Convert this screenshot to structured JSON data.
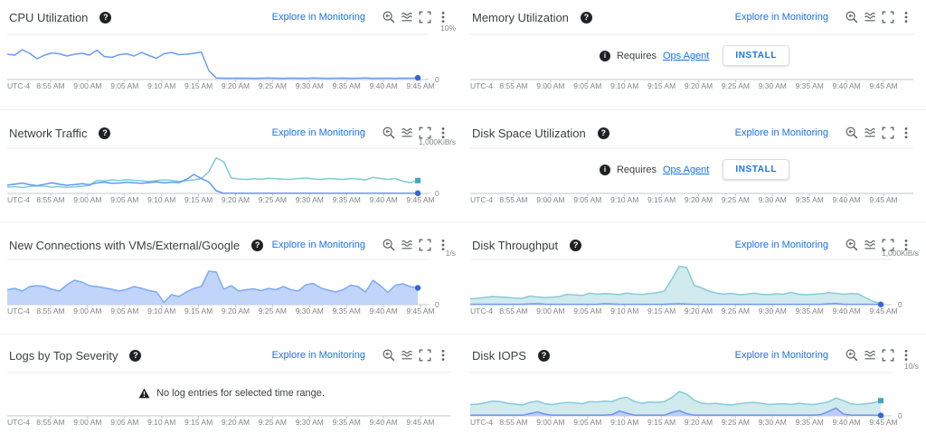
{
  "common": {
    "explore_label": "Explore in Monitoring",
    "help_glyph": "?",
    "tz_label": "UTC-4",
    "x_ticks": [
      "8:55 AM",
      "9:00 AM",
      "9:05 AM",
      "9:10 AM",
      "9:15 AM",
      "9:20 AM",
      "9:25 AM",
      "9:30 AM",
      "9:35 AM",
      "9:40 AM",
      "9:45 AM"
    ],
    "action_icons": [
      "zoom-reset-icon",
      "chart-options-icon",
      "fullscreen-icon",
      "more-options-icon"
    ],
    "colors": {
      "link": "#1a73e8",
      "blue_line": "#699cf7",
      "teal_line": "#7fcbd5",
      "blue_marker": "#3367d6",
      "teal_marker": "#41a8b8",
      "gridline": "#e8eaed",
      "axis": "#c4c7ca",
      "tick_text": "#80868b"
    }
  },
  "ops_message": {
    "info_glyph": "i",
    "requires": "Requires",
    "link": "Ops Agent",
    "install": "INSTALL"
  },
  "logs_message": {
    "text": "No log entries for selected time range."
  },
  "panels": [
    {
      "title": "CPU Utilization",
      "kind": "chart",
      "chart_index": 0
    },
    {
      "title": "Memory Utilization",
      "kind": "ops"
    },
    {
      "title": "Network Traffic",
      "kind": "chart",
      "chart_index": 1
    },
    {
      "title": "Disk Space Utilization",
      "kind": "ops"
    },
    {
      "title": "New Connections with VMs/External/Google",
      "kind": "chart",
      "chart_index": 2
    },
    {
      "title": "Disk Throughput",
      "kind": "chart",
      "chart_index": 3
    },
    {
      "title": "Logs by Top Severity",
      "kind": "logs"
    },
    {
      "title": "Disk IOPS",
      "kind": "chart",
      "chart_index": 4
    }
  ],
  "chart_data": [
    {
      "id": "cpu-utilization",
      "type": "line",
      "title": "CPU Utilization",
      "ylabel_top": "10%",
      "ylabel_bottom": "0",
      "ylim": [
        0,
        10
      ],
      "unit": "%",
      "series": [
        {
          "id": "series_blue",
          "color": "#699cf7",
          "marker": "circle",
          "marker_color": "#3367d6",
          "values": [
            5.6,
            5.4,
            6.6,
            5.8,
            4.6,
            5.4,
            5.9,
            5.7,
            5.2,
            5.6,
            5.8,
            5.4,
            6.5,
            5.1,
            4.9,
            5.5,
            5.7,
            5.2,
            6.0,
            5.3,
            4.7,
            5.7,
            6.0,
            5.5,
            5.6,
            5.8,
            6.1,
            2.0,
            0.35,
            0.3,
            0.3,
            0.32,
            0.3,
            0.28,
            0.3,
            0.33,
            0.3,
            0.28,
            0.32,
            0.3,
            0.28,
            0.35,
            0.3,
            0.28,
            0.3,
            0.32,
            0.28,
            0.3,
            0.33,
            0.28,
            0.3,
            0.3,
            0.28,
            0.32,
            0.3,
            0.38
          ]
        }
      ]
    },
    {
      "id": "network-traffic",
      "type": "line",
      "title": "Network Traffic",
      "ylabel_top": "1,000KiB/s",
      "ylabel_bottom": "0",
      "ylim": [
        0,
        1000
      ],
      "unit": "KiB/s",
      "series": [
        {
          "id": "series_teal",
          "color": "#7fcbd5",
          "marker": "square",
          "marker_color": "#41a8b8",
          "values": [
            140,
            150,
            130,
            155,
            170,
            160,
            140,
            150,
            135,
            145,
            160,
            175,
            290,
            280,
            300,
            285,
            305,
            290,
            280,
            265,
            285,
            300,
            290,
            265,
            285,
            300,
            330,
            480,
            790,
            700,
            345,
            320,
            310,
            325,
            315,
            335,
            325,
            315,
            310,
            330,
            340,
            320,
            310,
            330,
            320,
            310,
            330,
            320,
            300,
            355,
            330,
            310,
            330,
            270,
            240,
            285
          ]
        },
        {
          "id": "series_blue",
          "color": "#5e97f6",
          "marker": "circle",
          "marker_color": "#3367d6",
          "values": [
            185,
            205,
            230,
            195,
            170,
            205,
            235,
            205,
            180,
            195,
            215,
            195,
            235,
            250,
            225,
            230,
            250,
            235,
            225,
            240,
            255,
            235,
            250,
            240,
            310,
            420,
            330,
            255,
            60,
            5,
            5,
            5,
            5,
            5,
            5,
            5,
            5,
            5,
            5,
            5,
            5,
            5,
            5,
            5,
            5,
            5,
            5,
            5,
            5,
            5,
            5,
            5,
            5,
            5,
            5,
            5
          ]
        }
      ]
    },
    {
      "id": "new-connections-with-vms-external-google",
      "type": "area",
      "title": "New Connections with VMs/External/Google",
      "ylabel_top": "1/s",
      "ylabel_bottom": "0",
      "ylim": [
        0,
        1
      ],
      "unit": "1/s",
      "series": [
        {
          "id": "series_blue_area",
          "color": "#7baaf7",
          "fill": "#bdd3f9",
          "marker": "circle",
          "marker_color": "#3367d6",
          "values": [
            0.33,
            0.36,
            0.3,
            0.4,
            0.42,
            0.4,
            0.34,
            0.3,
            0.44,
            0.54,
            0.5,
            0.42,
            0.4,
            0.37,
            0.34,
            0.3,
            0.34,
            0.4,
            0.36,
            0.31,
            0.28,
            0.05,
            0.22,
            0.18,
            0.28,
            0.36,
            0.4,
            0.74,
            0.72,
            0.34,
            0.42,
            0.3,
            0.33,
            0.35,
            0.31,
            0.36,
            0.33,
            0.4,
            0.33,
            0.3,
            0.44,
            0.47,
            0.37,
            0.32,
            0.28,
            0.33,
            0.43,
            0.4,
            0.28,
            0.54,
            0.42,
            0.27,
            0.43,
            0.46,
            0.4,
            0.37
          ]
        }
      ]
    },
    {
      "id": "disk-throughput",
      "type": "area",
      "title": "Disk Throughput",
      "ylabel_top": "1,000KiB/s",
      "ylabel_bottom": "0",
      "ylim": [
        0,
        1000
      ],
      "unit": "KiB/s",
      "series": [
        {
          "id": "series_teal_area",
          "color": "#85ccd6",
          "fill": "#cde9ed",
          "values": [
            130,
            140,
            160,
            180,
            170,
            160,
            145,
            140,
            190,
            170,
            155,
            165,
            180,
            230,
            215,
            205,
            255,
            230,
            245,
            235,
            225,
            255,
            235,
            225,
            245,
            265,
            300,
            560,
            850,
            820,
            430,
            370,
            300,
            255,
            230,
            250,
            220,
            230,
            255,
            230,
            220,
            240,
            230,
            275,
            230,
            220,
            230,
            240,
            265,
            250,
            230,
            245,
            235,
            150,
            70,
            30
          ]
        },
        {
          "id": "series_blue_area",
          "color": "#7398f2",
          "fill": "#c3d3fa",
          "marker": "circle",
          "marker_color": "#3367d6",
          "values": [
            8,
            8,
            8,
            8,
            8,
            8,
            8,
            8,
            18,
            20,
            10,
            8,
            8,
            8,
            8,
            8,
            8,
            8,
            22,
            15,
            8,
            8,
            8,
            8,
            8,
            8,
            8,
            15,
            20,
            12,
            8,
            8,
            8,
            8,
            8,
            8,
            8,
            8,
            8,
            8,
            8,
            8,
            8,
            8,
            8,
            8,
            8,
            8,
            20,
            25,
            10,
            8,
            8,
            8,
            8,
            5
          ]
        }
      ]
    },
    {
      "id": "disk-iops",
      "type": "area",
      "title": "Disk IOPS",
      "ylabel_top": "10/s",
      "ylabel_bottom": "0",
      "ylim": [
        0,
        10
      ],
      "unit": "1/s",
      "series": [
        {
          "id": "series_teal_area",
          "color": "#85ccd6",
          "fill": "#cde9ed",
          "marker": "square",
          "marker_color": "#41a8b8",
          "values": [
            2.6,
            2.7,
            3.0,
            3.4,
            3.3,
            2.9,
            2.7,
            2.5,
            3.1,
            3.4,
            2.8,
            2.6,
            2.9,
            3.1,
            3.0,
            2.8,
            3.3,
            3.2,
            3.4,
            3.3,
            4.0,
            4.3,
            3.3,
            2.9,
            3.2,
            3.1,
            3.3,
            4.2,
            5.6,
            5.0,
            3.6,
            2.9,
            2.8,
            2.9,
            2.6,
            2.5,
            2.8,
            3.0,
            3.1,
            2.9,
            2.6,
            2.7,
            2.8,
            2.6,
            2.9,
            2.7,
            2.6,
            2.9,
            3.2,
            4.1,
            3.5,
            2.8,
            2.6,
            2.8,
            3.0,
            3.5
          ]
        },
        {
          "id": "series_blue_area",
          "color": "#6e93f0",
          "fill": "#bac9f8",
          "marker": "circle",
          "marker_color": "#3367d6",
          "values": [
            0.15,
            0.15,
            0.15,
            0.15,
            0.15,
            0.15,
            0.15,
            0.15,
            0.5,
            0.9,
            0.4,
            0.15,
            0.15,
            0.15,
            0.15,
            0.15,
            0.15,
            0.15,
            0.15,
            0.3,
            1.1,
            0.6,
            0.15,
            0.15,
            0.15,
            0.15,
            0.15,
            0.8,
            1.2,
            0.5,
            0.15,
            0.15,
            0.15,
            0.15,
            0.15,
            0.15,
            0.15,
            0.15,
            0.15,
            0.15,
            0.15,
            0.15,
            0.15,
            0.15,
            0.15,
            0.15,
            0.15,
            0.3,
            1.0,
            1.8,
            0.4,
            0.15,
            0.15,
            0.15,
            0.15,
            0.1
          ]
        }
      ]
    }
  ]
}
